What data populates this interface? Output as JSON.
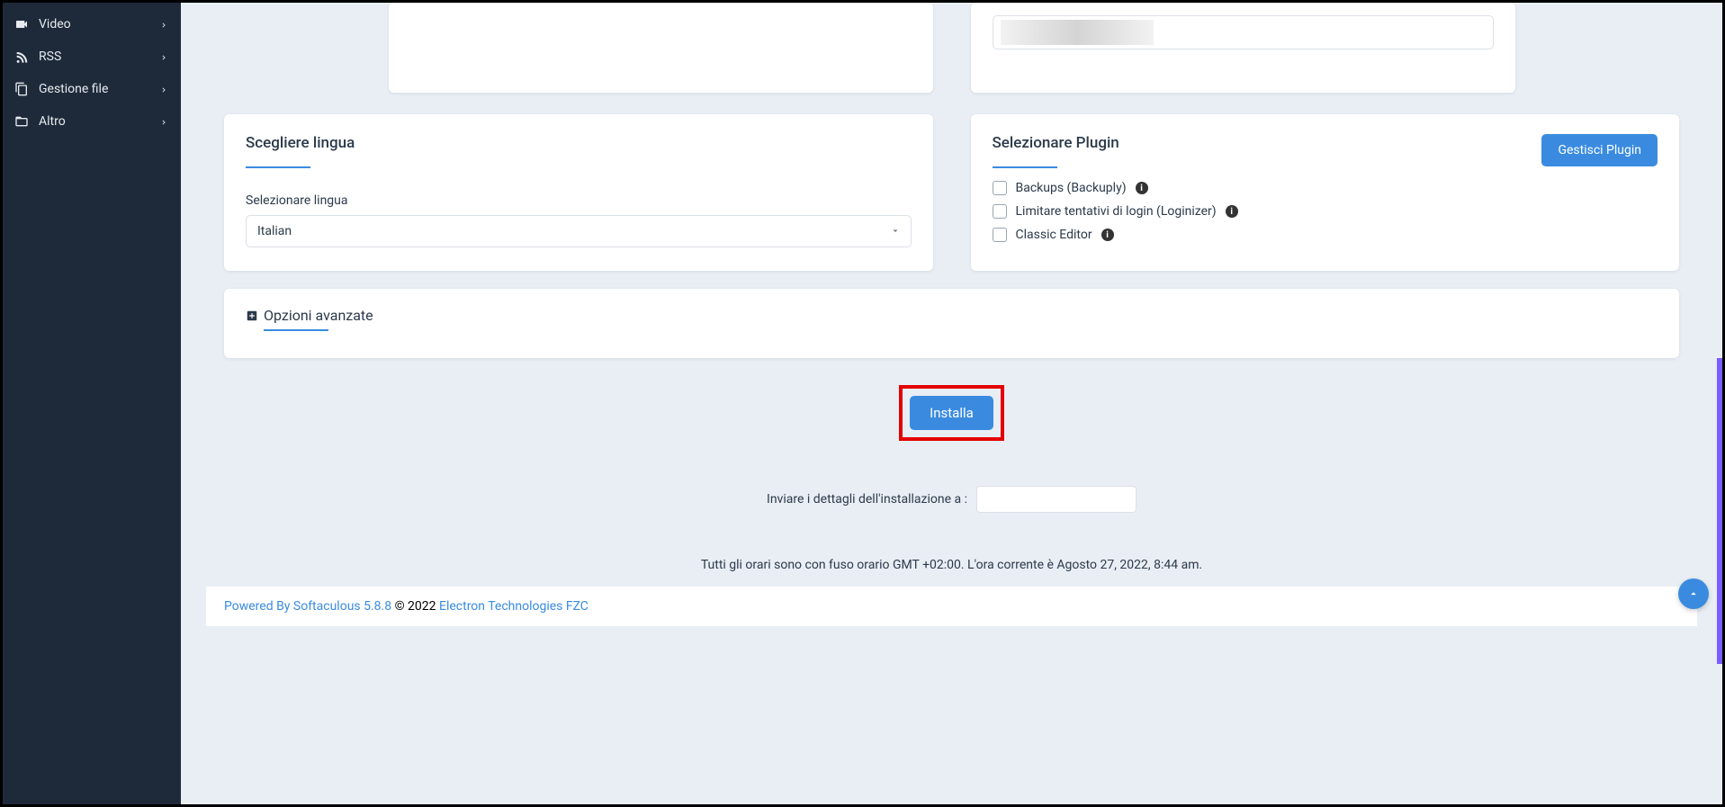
{
  "sidebar": {
    "items": [
      {
        "label": "Video",
        "icon": "video-icon"
      },
      {
        "label": "RSS",
        "icon": "rss-icon"
      },
      {
        "label": "Gestione file",
        "icon": "file-manager-icon"
      },
      {
        "label": "Altro",
        "icon": "folder-open-icon"
      }
    ]
  },
  "cards": {
    "top_right_input_value": ""
  },
  "language_card": {
    "title": "Scegliere lingua",
    "label": "Selezionare lingua",
    "selected": "Italian"
  },
  "plugin_card": {
    "title": "Selezionare Plugin",
    "manage_button": "Gestisci Plugin",
    "items": [
      {
        "label": "Backups (Backuply)"
      },
      {
        "label": "Limitare tentativi di login (Loginizer)"
      },
      {
        "label": "Classic Editor"
      }
    ]
  },
  "advanced": {
    "title": "Opzioni avanzate"
  },
  "install": {
    "button": "Installa",
    "email_label": "Inviare i dettagli dell'installazione a :",
    "email_value": ""
  },
  "timezone": "Tutti gli orari sono con fuso orario GMT +02:00. L'ora corrente è Agosto 27, 2022, 8:44 am.",
  "footer": {
    "powered_by": "Powered By Softaculous 5.8.8",
    "copyright": " © 2022 ",
    "company": "Electron Technologies FZC"
  }
}
